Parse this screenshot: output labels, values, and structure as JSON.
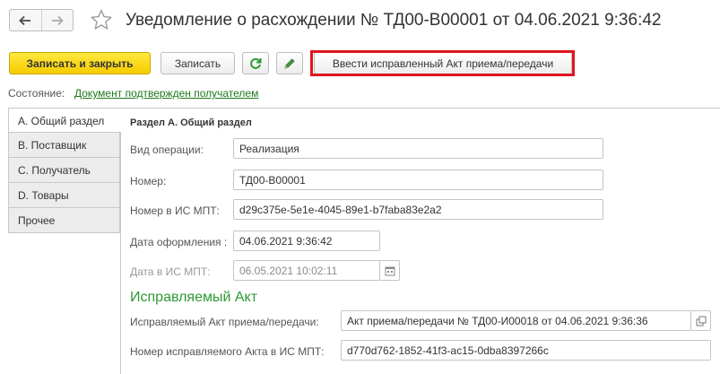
{
  "window": {
    "title": "Уведомление о расхождении № ТД00-В00001 от 04.06.2021 9:36:42",
    "back_icon": "arrow-left-icon",
    "forward_icon": "arrow-right-icon",
    "favorite_icon": "star-icon"
  },
  "toolbar": {
    "save_close_label": "Записать и закрыть",
    "save_label": "Записать",
    "refresh_icon": "refresh-icon",
    "edit_icon": "pencil-icon",
    "corrected_act_label": "Ввести исправленный Акт приема/передачи"
  },
  "state": {
    "label": "Состояние:",
    "value": "Документ подтвержден получателем"
  },
  "tabs": [
    {
      "label": "А. Общий раздел",
      "active": true
    },
    {
      "label": "В. Поставщик",
      "active": false
    },
    {
      "label": "С. Получатель",
      "active": false
    },
    {
      "label": "D. Товары",
      "active": false
    },
    {
      "label": "Прочее",
      "active": false
    }
  ],
  "form": {
    "section_title": "Раздел А. Общий раздел",
    "operation_label": "Вид операции:",
    "operation_value": "Реализация",
    "number_label": "Номер:",
    "number_value": "ТД00-В00001",
    "mpt_number_label": "Номер в ИС МПТ:",
    "mpt_number_value": "d29c375e-5e1e-4045-89e1-b7faba83e2a2",
    "issue_date_label": "Дата оформления :",
    "issue_date_value": "04.06.2021  9:36:42",
    "mpt_date_label": "Дата в ИС МПТ:",
    "mpt_date_value": "06.05.2021 10:02:11",
    "calendar_icon": "calendar-icon"
  },
  "corrected": {
    "group_title": "Исправляемый Акт",
    "act_label": "Исправляемый Акт приема/передачи:",
    "act_value": "Акт приема/передачи № ТД00-И00018 от 04.06.2021 9:36:36",
    "open_icon": "open-window-icon",
    "act_number_label": "Номер исправляемого Акта в ИС МПТ:",
    "act_number_value": "d770d762-1852-41f3-ac15-0dba8397266c"
  },
  "colors": {
    "primary_button": "#f5cc00",
    "highlight_border": "#e0161e",
    "link_green": "#1c7a1c",
    "group_title_green": "#2e9a34"
  }
}
